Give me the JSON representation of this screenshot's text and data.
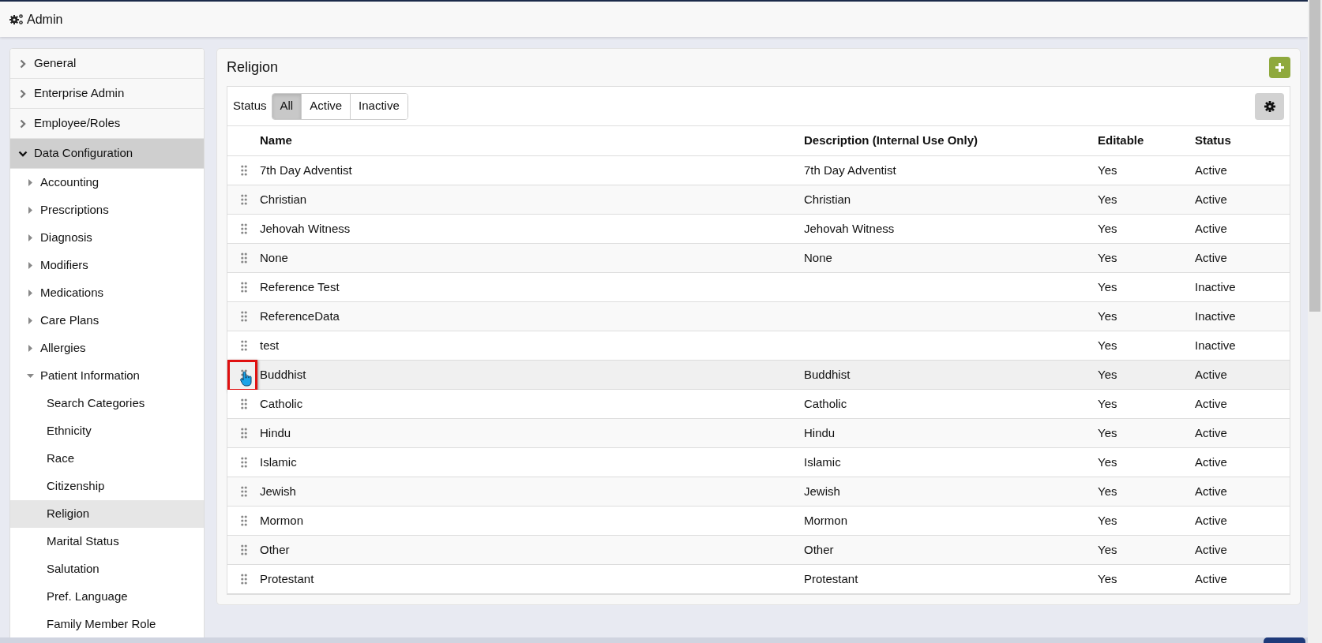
{
  "header": {
    "title": "Admin"
  },
  "sidebar": {
    "items": [
      {
        "label": "General",
        "expanded": false,
        "selected": false
      },
      {
        "label": "Enterprise Admin",
        "expanded": false,
        "selected": false
      },
      {
        "label": "Employee/Roles",
        "expanded": false,
        "selected": false
      },
      {
        "label": "Data Configuration",
        "expanded": true,
        "selected": true,
        "children": [
          {
            "label": "Accounting",
            "expanded": false,
            "selected": false
          },
          {
            "label": "Prescriptions",
            "expanded": false,
            "selected": false
          },
          {
            "label": "Diagnosis",
            "expanded": false,
            "selected": false
          },
          {
            "label": "Modifiers",
            "expanded": false,
            "selected": false
          },
          {
            "label": "Medications",
            "expanded": false,
            "selected": false
          },
          {
            "label": "Care Plans",
            "expanded": false,
            "selected": false
          },
          {
            "label": "Allergies",
            "expanded": false,
            "selected": false
          },
          {
            "label": "Patient Information",
            "expanded": true,
            "selected": false,
            "children": [
              {
                "label": "Search Categories",
                "selected": false
              },
              {
                "label": "Ethnicity",
                "selected": false
              },
              {
                "label": "Race",
                "selected": false
              },
              {
                "label": "Citizenship",
                "selected": false
              },
              {
                "label": "Religion",
                "selected": true
              },
              {
                "label": "Marital Status",
                "selected": false
              },
              {
                "label": "Salutation",
                "selected": false
              },
              {
                "label": "Pref. Language",
                "selected": false
              },
              {
                "label": "Family Member Role",
                "selected": false
              }
            ]
          }
        ]
      }
    ]
  },
  "panel": {
    "title": "Religion",
    "filter": {
      "label": "Status",
      "options": [
        {
          "label": "All",
          "selected": true
        },
        {
          "label": "Active",
          "selected": false
        },
        {
          "label": "Inactive",
          "selected": false
        }
      ]
    },
    "table": {
      "columns": [
        "Name",
        "Description (Internal Use Only)",
        "Editable",
        "Status"
      ],
      "rows": [
        {
          "name": "7th Day Adventist",
          "description": "7th Day Adventist",
          "editable": "Yes",
          "status": "Active",
          "hovered": false
        },
        {
          "name": "Christian",
          "description": "Christian",
          "editable": "Yes",
          "status": "Active",
          "hovered": false
        },
        {
          "name": "Jehovah Witness",
          "description": "Jehovah Witness",
          "editable": "Yes",
          "status": "Active",
          "hovered": false
        },
        {
          "name": "None",
          "description": "None",
          "editable": "Yes",
          "status": "Active",
          "hovered": false
        },
        {
          "name": "Reference Test",
          "editable": "Yes",
          "status": "Inactive",
          "hovered": false
        },
        {
          "name": "ReferenceData",
          "editable": "Yes",
          "status": "Inactive",
          "hovered": false
        },
        {
          "name": "test",
          "editable": "Yes",
          "status": "Inactive",
          "hovered": false
        },
        {
          "name": "Buddhist",
          "description": "Buddhist",
          "editable": "Yes",
          "status": "Active",
          "hovered": true
        },
        {
          "name": "Catholic",
          "description": "Catholic",
          "editable": "Yes",
          "status": "Active",
          "hovered": false
        },
        {
          "name": "Hindu",
          "description": "Hindu",
          "editable": "Yes",
          "status": "Active",
          "hovered": false
        },
        {
          "name": "Islamic",
          "description": "Islamic",
          "editable": "Yes",
          "status": "Active",
          "hovered": false
        },
        {
          "name": "Jewish",
          "description": "Jewish",
          "editable": "Yes",
          "status": "Active",
          "hovered": false
        },
        {
          "name": "Mormon",
          "description": "Mormon",
          "editable": "Yes",
          "status": "Active",
          "hovered": false
        },
        {
          "name": "Other",
          "description": "Other",
          "editable": "Yes",
          "status": "Active",
          "hovered": false
        },
        {
          "name": "Protestant",
          "description": "Protestant",
          "editable": "Yes",
          "status": "Active",
          "hovered": false
        }
      ]
    }
  }
}
